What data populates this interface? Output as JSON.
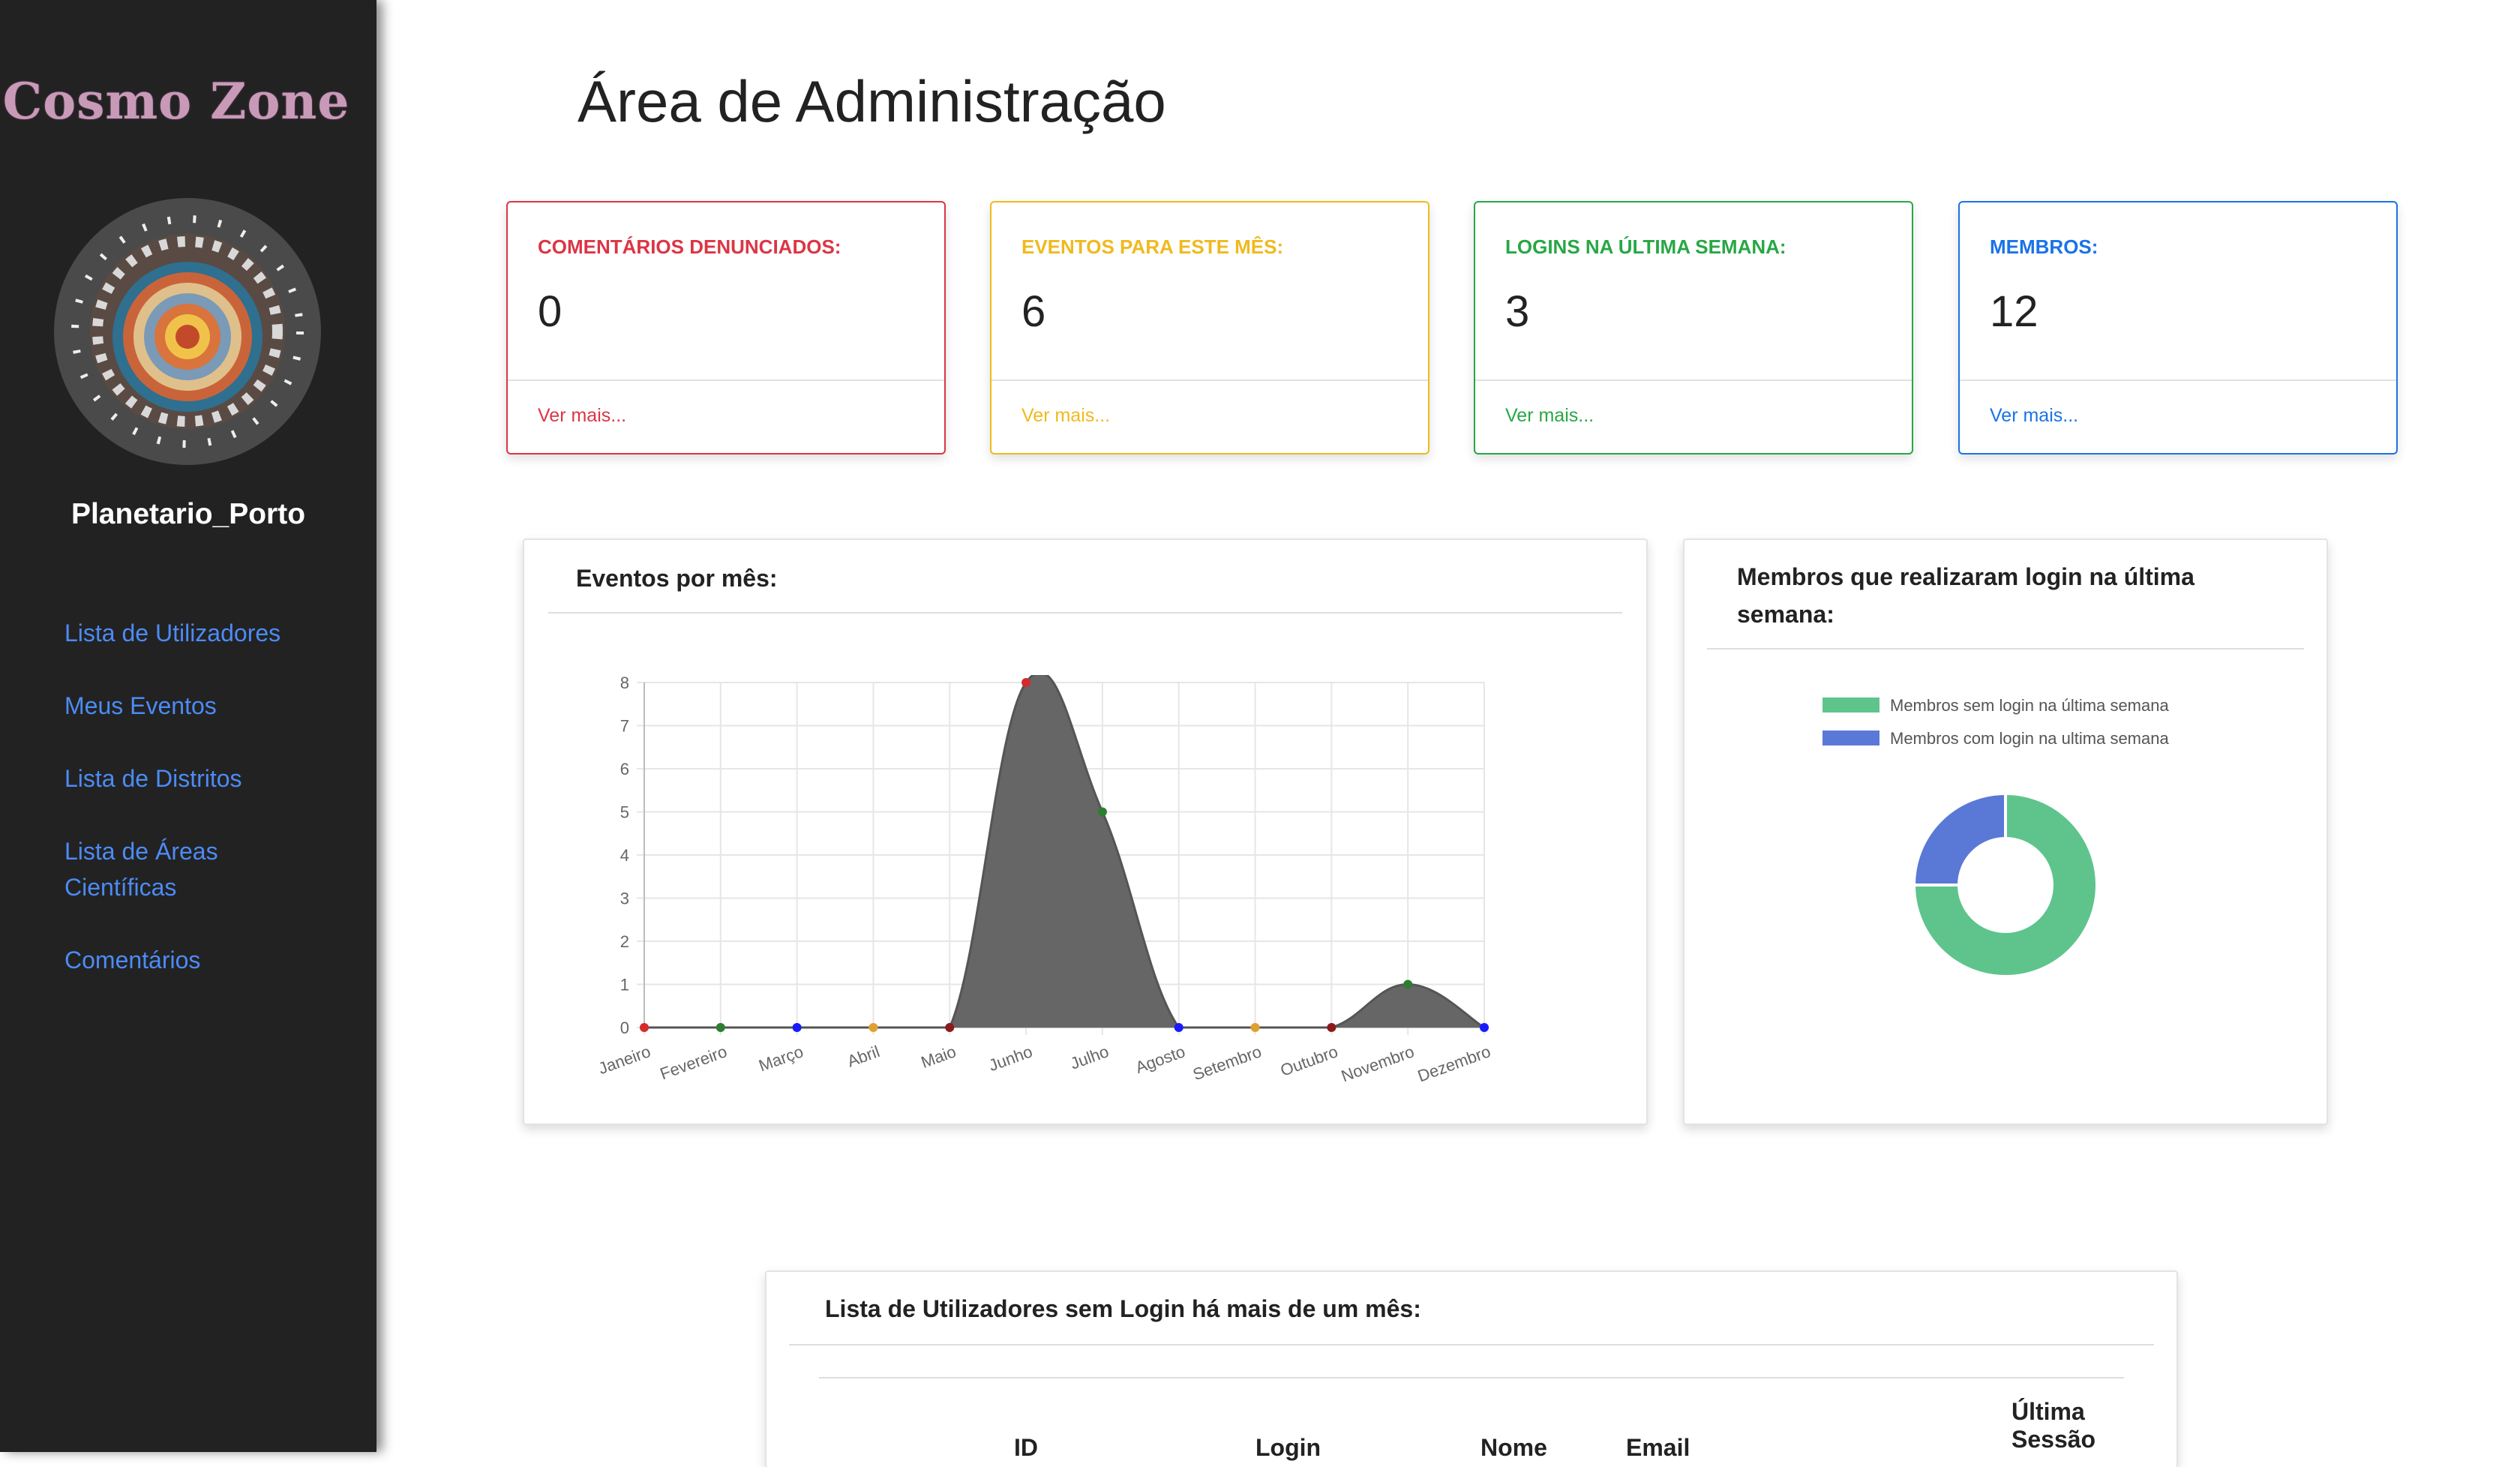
{
  "sidebar": {
    "brand": "Cosmo Zone",
    "username": "Planetario_Porto",
    "items": [
      {
        "label": "Lista de Utilizadores"
      },
      {
        "label": "Meus Eventos"
      },
      {
        "label": "Lista de Distritos"
      },
      {
        "label": "Lista de Áreas",
        "label2": "Científicas"
      },
      {
        "label": "Comentários"
      }
    ]
  },
  "main": {
    "title": "Área de Administração",
    "cards": [
      {
        "label": "Comentários denunciados:",
        "value": "0",
        "link": "Ver mais...",
        "color": "#dc3545"
      },
      {
        "label": "Eventos para este mês:",
        "value": "6",
        "link": "Ver mais...",
        "color": "#f0b91e"
      },
      {
        "label": "Logins na última semana:",
        "value": "3",
        "link": "Ver mais...",
        "color": "#28a745"
      },
      {
        "label": "Membros:",
        "value": "12",
        "link": "Ver mais...",
        "color": "#1a73e8"
      }
    ],
    "events_panel": {
      "title": "Eventos por mês:"
    },
    "logins_panel": {
      "title_line1": "Membros que realizaram login na última",
      "title_line2": "semana:"
    },
    "users_panel": {
      "title": "Lista de Utilizadores sem Login há mais de um mês:",
      "columns": [
        "ID",
        "Login",
        "Nome",
        "Email",
        "Última",
        "Sessão"
      ]
    }
  },
  "chart_data": [
    {
      "type": "area",
      "title": "Eventos por mês:",
      "categories": [
        "Janeiro",
        "Fevereiro",
        "Março",
        "Abril",
        "Maio",
        "Junho",
        "Julho",
        "Agosto",
        "Setembro",
        "Outubro",
        "Novembro",
        "Dezembro"
      ],
      "values": [
        0,
        0,
        0,
        0,
        0,
        8,
        5,
        0,
        0,
        0,
        1,
        0
      ],
      "point_colors": [
        "#d62b2b",
        "#2e7d32",
        "#1a1aff",
        "#e0a030",
        "#8b1a1a",
        "#d62b2b",
        "#2e7d32",
        "#1a1aff",
        "#e0a030",
        "#8b1a1a",
        "#2e7d32",
        "#1a1aff"
      ],
      "fill_color": "#666666",
      "ylim": [
        0,
        8
      ],
      "yticks": [
        "0",
        "1",
        "2",
        "3",
        "4",
        "5",
        "6",
        "7",
        "8"
      ],
      "grid": true
    },
    {
      "type": "pie",
      "title": "Membros que realizaram login na última semana:",
      "labels": [
        "Membros sem login na última semana",
        "Membros com login na ultima semana"
      ],
      "values": [
        9,
        3
      ],
      "colors": [
        "#5ec48c",
        "#5a78d6"
      ],
      "legend": "top"
    }
  ]
}
